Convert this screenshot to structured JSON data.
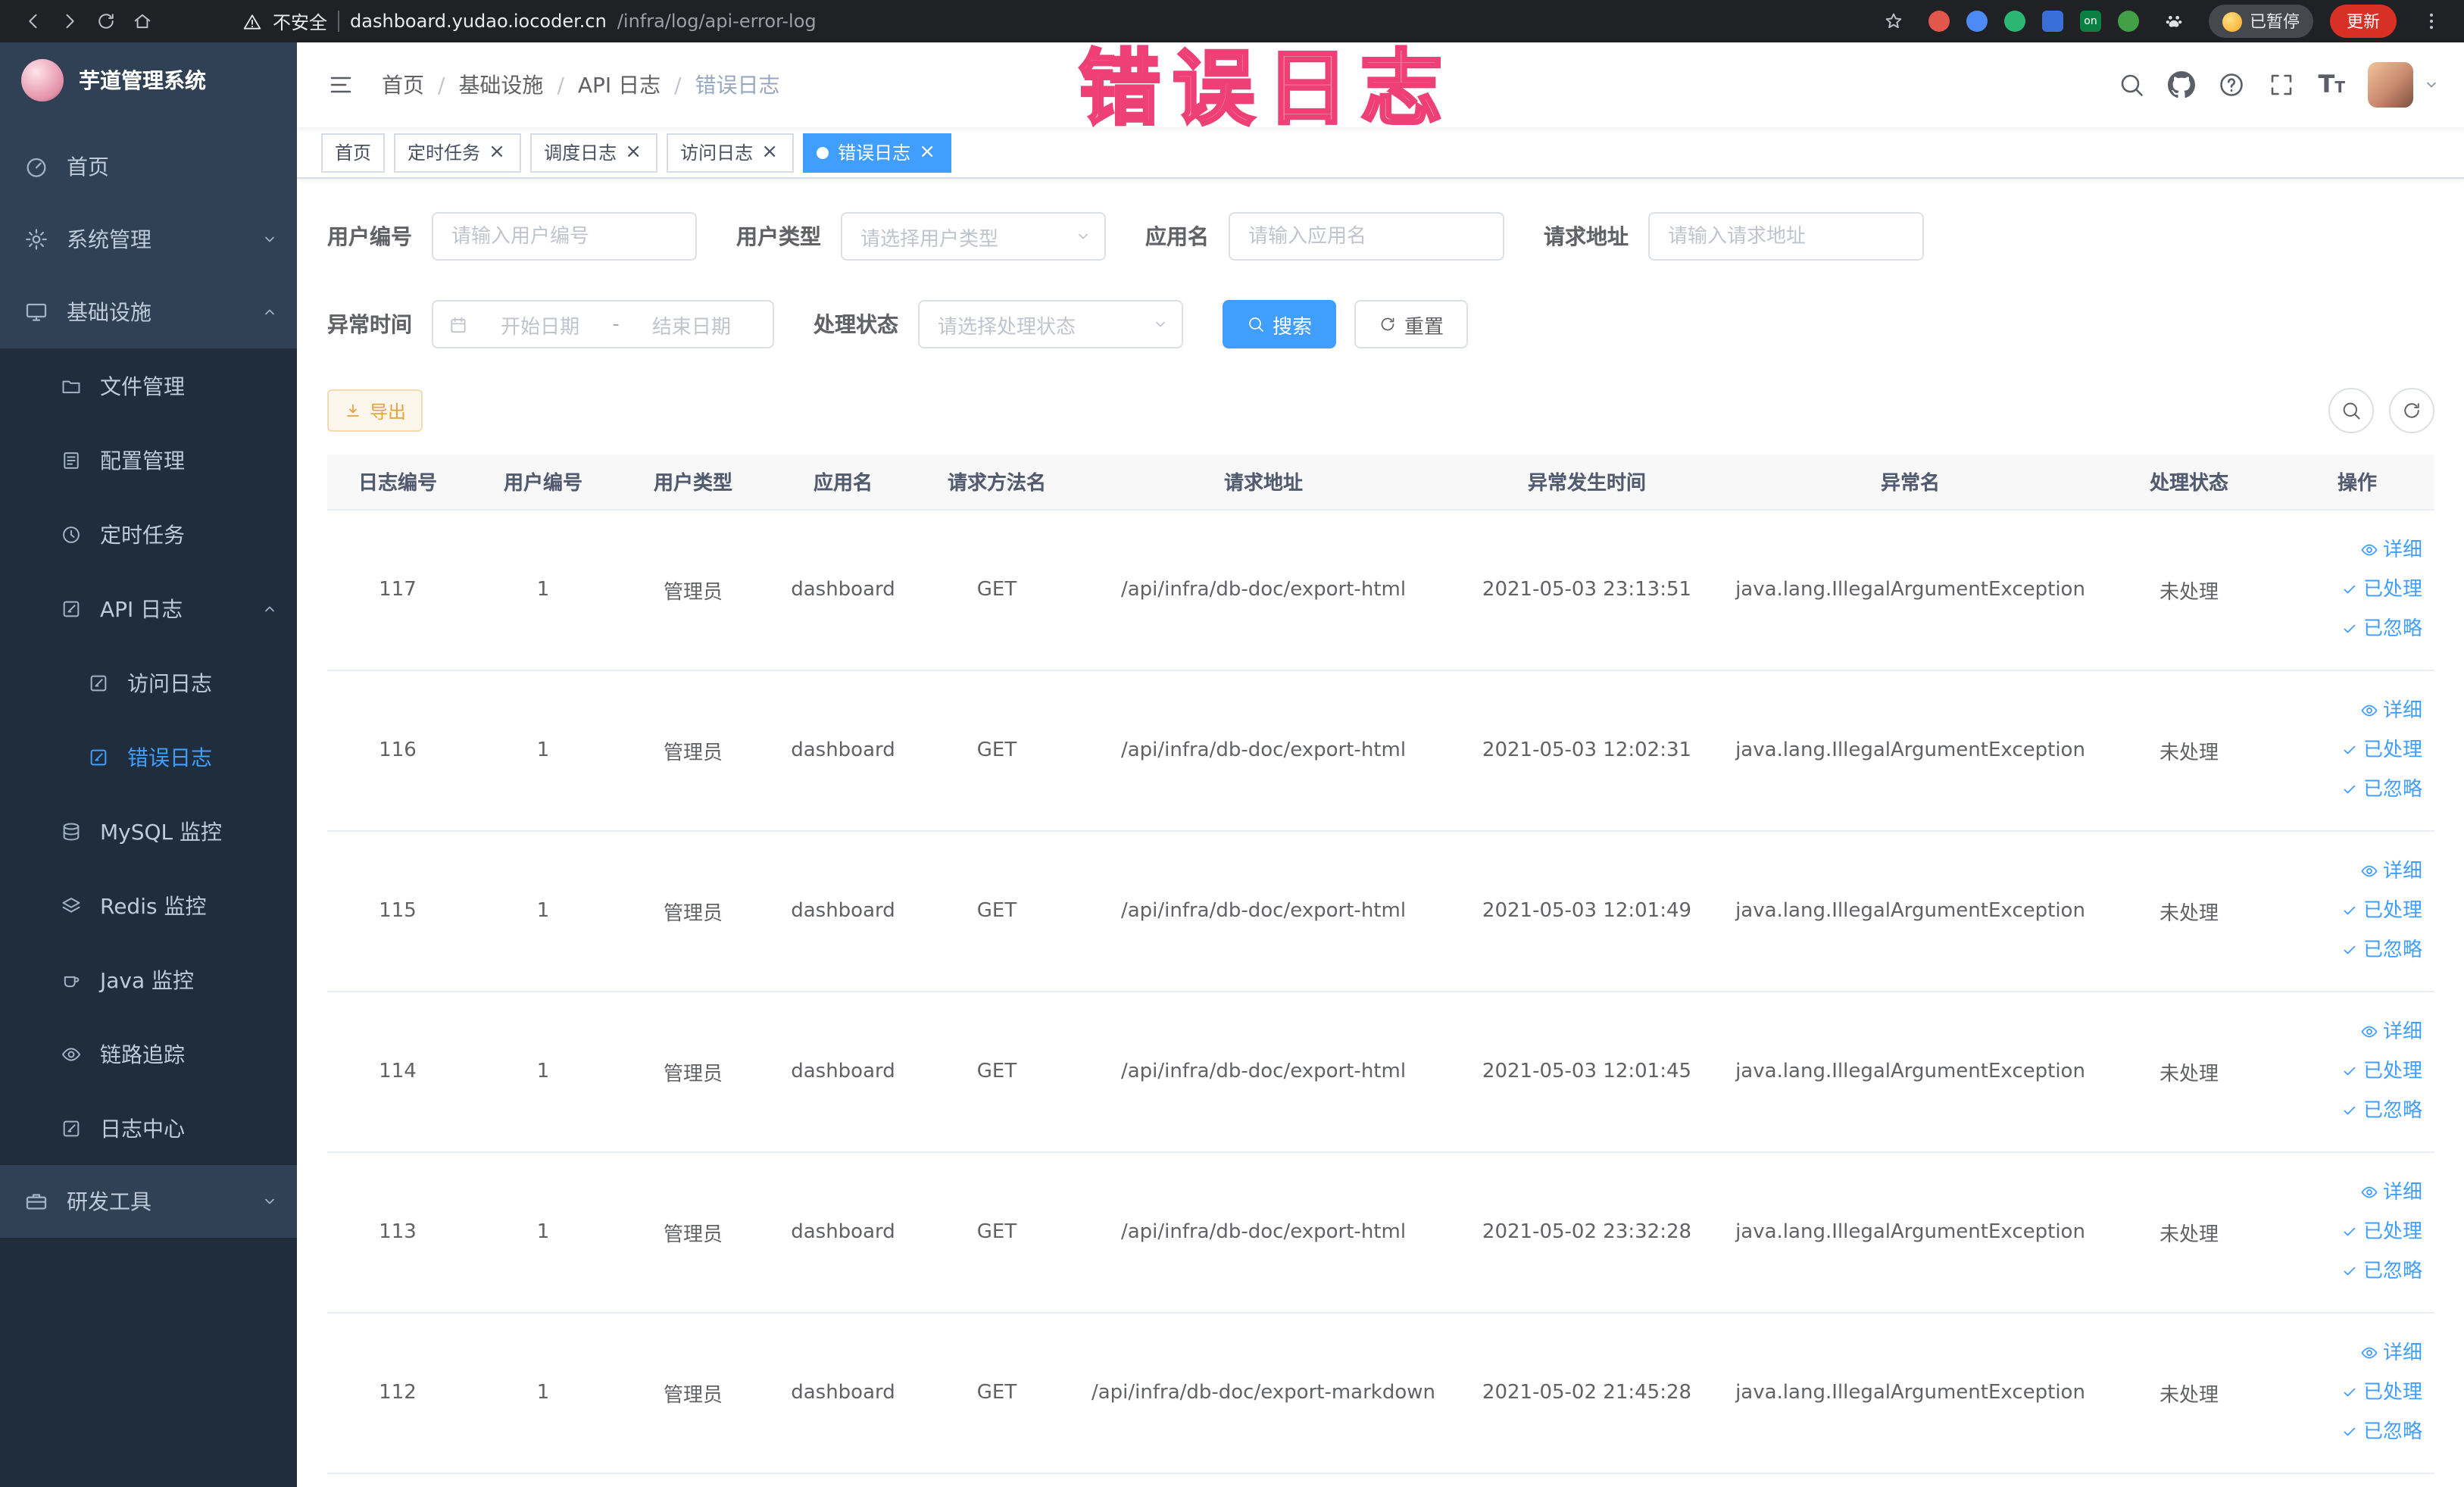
{
  "browser": {
    "security_label": "不安全",
    "url_domain": "dashboard.yudao.iocoder.cn",
    "url_path": "/infra/log/api-error-log",
    "paused_label": "已暂停",
    "update_label": "更新",
    "extension_on_label": "on"
  },
  "annotation": {
    "text": "错误日志"
  },
  "sidebar": {
    "title": "芋道管理系统",
    "items": [
      {
        "label": "首页"
      },
      {
        "label": "系统管理"
      },
      {
        "label": "基础设施",
        "children": [
          {
            "label": "文件管理"
          },
          {
            "label": "配置管理"
          },
          {
            "label": "定时任务"
          },
          {
            "label": "API 日志",
            "children": [
              {
                "label": "访问日志"
              },
              {
                "label": "错误日志"
              }
            ]
          },
          {
            "label": "MySQL 监控"
          },
          {
            "label": "Redis 监控"
          },
          {
            "label": "Java 监控"
          },
          {
            "label": "链路追踪"
          },
          {
            "label": "日志中心"
          }
        ]
      },
      {
        "label": "研发工具"
      }
    ]
  },
  "breadcrumb": {
    "items": [
      "首页",
      "基础设施",
      "API 日志",
      "错误日志"
    ]
  },
  "tabs": [
    {
      "label": "首页"
    },
    {
      "label": "定时任务"
    },
    {
      "label": "调度日志"
    },
    {
      "label": "访问日志"
    },
    {
      "label": "错误日志",
      "active": true
    }
  ],
  "filters": {
    "user_id": {
      "label": "用户编号",
      "placeholder": "请输入用户编号"
    },
    "user_type": {
      "label": "用户类型",
      "placeholder": "请选择用户类型"
    },
    "app_name": {
      "label": "应用名",
      "placeholder": "请输入应用名"
    },
    "request_url": {
      "label": "请求地址",
      "placeholder": "请输入请求地址"
    },
    "exception_time": {
      "label": "异常时间",
      "start_placeholder": "开始日期",
      "end_placeholder": "结束日期",
      "separator": "-"
    },
    "process_status": {
      "label": "处理状态",
      "placeholder": "请选择处理状态"
    },
    "search_label": "搜索",
    "reset_label": "重置"
  },
  "toolbar": {
    "export_label": "导出"
  },
  "table": {
    "headers": [
      "日志编号",
      "用户编号",
      "用户类型",
      "应用名",
      "请求方法名",
      "请求地址",
      "异常发生时间",
      "异常名",
      "处理状态",
      "操作"
    ],
    "action_labels": [
      "详细",
      "已处理",
      "已忽略"
    ],
    "rows": [
      {
        "id": "117",
        "user_id": "1",
        "user_type": "管理员",
        "app": "dashboard",
        "method": "GET",
        "url": "/api/infra/db-doc/export-html",
        "time": "2021-05-03 23:13:51",
        "exception": "java.lang.IllegalArgumentException",
        "status": "未处理"
      },
      {
        "id": "116",
        "user_id": "1",
        "user_type": "管理员",
        "app": "dashboard",
        "method": "GET",
        "url": "/api/infra/db-doc/export-html",
        "time": "2021-05-03 12:02:31",
        "exception": "java.lang.IllegalArgumentException",
        "status": "未处理"
      },
      {
        "id": "115",
        "user_id": "1",
        "user_type": "管理员",
        "app": "dashboard",
        "method": "GET",
        "url": "/api/infra/db-doc/export-html",
        "time": "2021-05-03 12:01:49",
        "exception": "java.lang.IllegalArgumentException",
        "status": "未处理"
      },
      {
        "id": "114",
        "user_id": "1",
        "user_type": "管理员",
        "app": "dashboard",
        "method": "GET",
        "url": "/api/infra/db-doc/export-html",
        "time": "2021-05-03 12:01:45",
        "exception": "java.lang.IllegalArgumentException",
        "status": "未处理"
      },
      {
        "id": "113",
        "user_id": "1",
        "user_type": "管理员",
        "app": "dashboard",
        "method": "GET",
        "url": "/api/infra/db-doc/export-html",
        "time": "2021-05-02 23:32:28",
        "exception": "java.lang.IllegalArgumentException",
        "status": "未处理"
      },
      {
        "id": "112",
        "user_id": "1",
        "user_type": "管理员",
        "app": "dashboard",
        "method": "GET",
        "url": "/api/infra/db-doc/export-markdown",
        "time": "2021-05-02 21:45:28",
        "exception": "java.lang.IllegalArgumentException",
        "status": "未处理"
      }
    ]
  },
  "colors": {
    "accent": "#409eff",
    "sidebar_bg": "#304156",
    "submenu_bg": "#1f2d3d",
    "warning": "#e6a23c",
    "annotation_pink": "#ee3f77"
  }
}
